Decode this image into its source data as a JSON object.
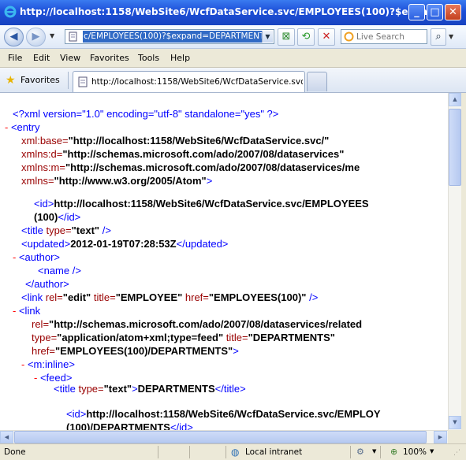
{
  "window": {
    "title": "http://localhost:1158/WebSite6/WcfDataService.svc/EMPLOYEES(100)?$expa...",
    "minimize": "_",
    "maximize": "□",
    "close": "✕"
  },
  "nav": {
    "address": "c/EMPLOYEES(100)?$expand=DEPARTMENTS",
    "search_placeholder": "Live Search"
  },
  "menu": [
    "File",
    "Edit",
    "View",
    "Favorites",
    "Tools",
    "Help"
  ],
  "favorites": {
    "label": "Favorites",
    "tab_title": "http://localhost:1158/WebSite6/WcfDataService.svc/..."
  },
  "xml": {
    "decl": "<?xml version=\"1.0\" encoding=\"utf-8\" standalone=\"yes\" ?>",
    "minus": "-",
    "entry_tag": "<entry",
    "attr_xmlbase_name": "xml:base=",
    "attr_xmlbase_value": "\"http://localhost:1158/WebSite6/WcfDataService.svc/\"",
    "attr_xmlnsd_name": "xmlns:d=",
    "attr_xmlnsd_value": "\"http://schemas.microsoft.com/ado/2007/08/dataservices\"",
    "attr_xmlnsm_name": "xmlns:m=",
    "attr_xmlnsm_value": "\"http://schemas.microsoft.com/ado/2007/08/dataservices/me",
    "attr_xmlns_name": "xmlns=",
    "attr_xmlns_value": "\"http://www.w3.org/2005/Atom\"",
    "entry_close_bracket": ">",
    "id_open": "<id>",
    "id_text_1": "http://localhost:1158/WebSite6/WcfDataService.svc/EMPLOYEES",
    "id_text_2": "(100)",
    "id_close": "</id>",
    "title_open": "<title",
    "attr_type_name": "type=",
    "attr_type_text_value": "\"text\"",
    "selfclose": "/>",
    "updated_open": "<updated>",
    "updated_text": "2012-01-19T07:28:53Z",
    "updated_close": "</updated>",
    "author_open": "<author>",
    "name_tag": "<name />",
    "author_close": "</author>",
    "link_open": "<link",
    "attr_rel_name": "rel=",
    "link1_rel_value": "\"edit\"",
    "attr_title_name": "title=",
    "link1_title_value": "\"EMPLOYEE\"",
    "attr_href_name": "href=",
    "link1_href_value": "\"EMPLOYEES(100)\"",
    "link2_rel_value": "\"http://schemas.microsoft.com/ado/2007/08/dataservices/related",
    "link2_type_value": "\"application/atom+xml;type=feed\"",
    "link2_title_value": "\"DEPARTMENTS\"",
    "link2_href_value": "\"EMPLOYEES(100)/DEPARTMENTS\"",
    "close_bracket": ">",
    "minline_open": "<m:inline>",
    "feed_open": "<feed>",
    "feed_title_text": "DEPARTMENTS",
    "title_close": "</title>",
    "id2_text_1": "http://localhost:1158/WebSite6/WcfDataService.svc/EMPLOY",
    "id2_text_2": "(100)/DEPARTMENTS"
  },
  "status": {
    "done": "Done",
    "zone": "Local intranet",
    "zoom": "100%"
  }
}
